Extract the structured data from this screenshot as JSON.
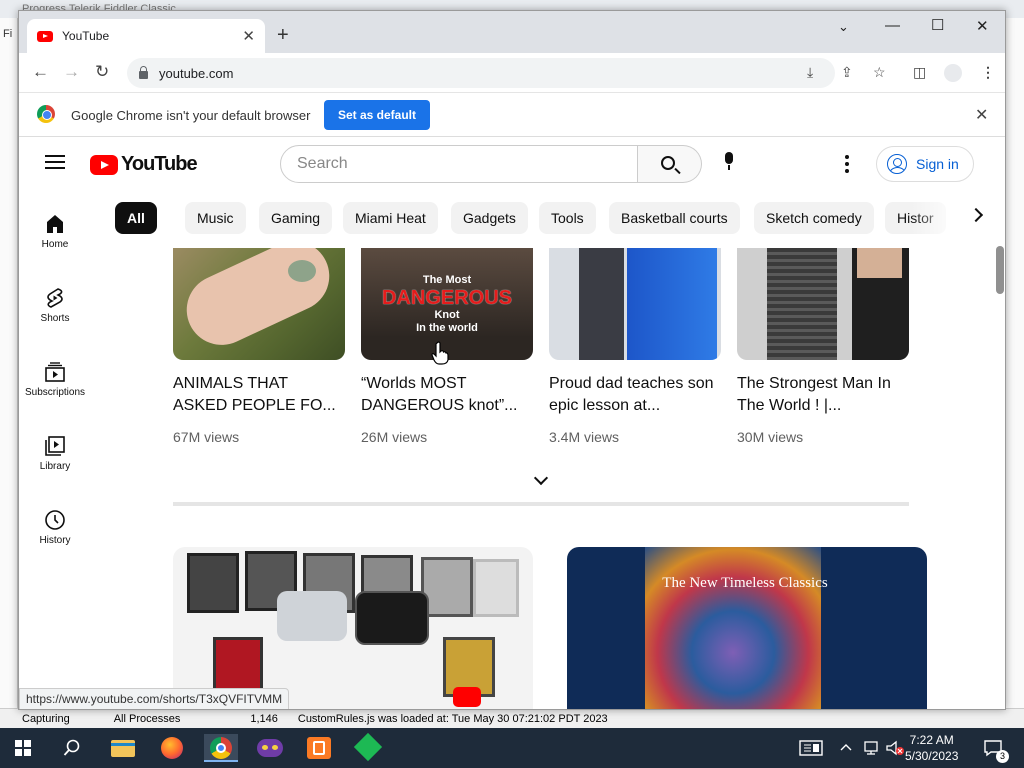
{
  "background_app": {
    "title": "Progress Telerik Fiddler Classic",
    "menu_initial": "Fi",
    "status": {
      "capturing": "Capturing",
      "processes": "All Processes",
      "count": "1,146",
      "message": "CustomRules.js was loaded at: Tue May 30 07:21:02 PDT 2023"
    }
  },
  "browser": {
    "tab_title": "YouTube",
    "url": "youtube.com",
    "infobar": {
      "message": "Google Chrome isn't your default browser",
      "button": "Set as default"
    },
    "status_url": "https://www.youtube.com/shorts/T3xQVFITVMM"
  },
  "youtube": {
    "logo": "YouTube",
    "search_placeholder": "Search",
    "sign_in": "Sign in",
    "sidebar": [
      {
        "label": "Home",
        "icon": "home-icon"
      },
      {
        "label": "Shorts",
        "icon": "shorts-icon"
      },
      {
        "label": "Subscriptions",
        "icon": "subscriptions-icon"
      },
      {
        "label": "Library",
        "icon": "library-icon"
      },
      {
        "label": "History",
        "icon": "history-icon"
      }
    ],
    "chips": [
      "All",
      "Music",
      "Gaming",
      "Miami Heat",
      "Gadgets",
      "Tools",
      "Basketball courts",
      "Sketch comedy",
      "Histor"
    ],
    "shorts": [
      {
        "title": "ANIMALS THAT ASKED PEOPLE FO...",
        "views": "67M views"
      },
      {
        "title": "“Worlds MOST DANGEROUS knot”...",
        "views": "26M views",
        "thumb_text": [
          "The Most",
          "DANGEROUS",
          "Knot",
          "In the world"
        ]
      },
      {
        "title": "Proud dad teaches son epic lesson at...",
        "views": "3.4M views"
      },
      {
        "title": "The Strongest Man In The World ! |...",
        "views": "30M views"
      }
    ],
    "videos": [
      {
        "thumb_text": ""
      },
      {
        "thumb_text": "The New Timeless Classics"
      }
    ]
  },
  "taskbar": {
    "time": "7:22 AM",
    "date": "5/30/2023",
    "notification_count": "3"
  }
}
